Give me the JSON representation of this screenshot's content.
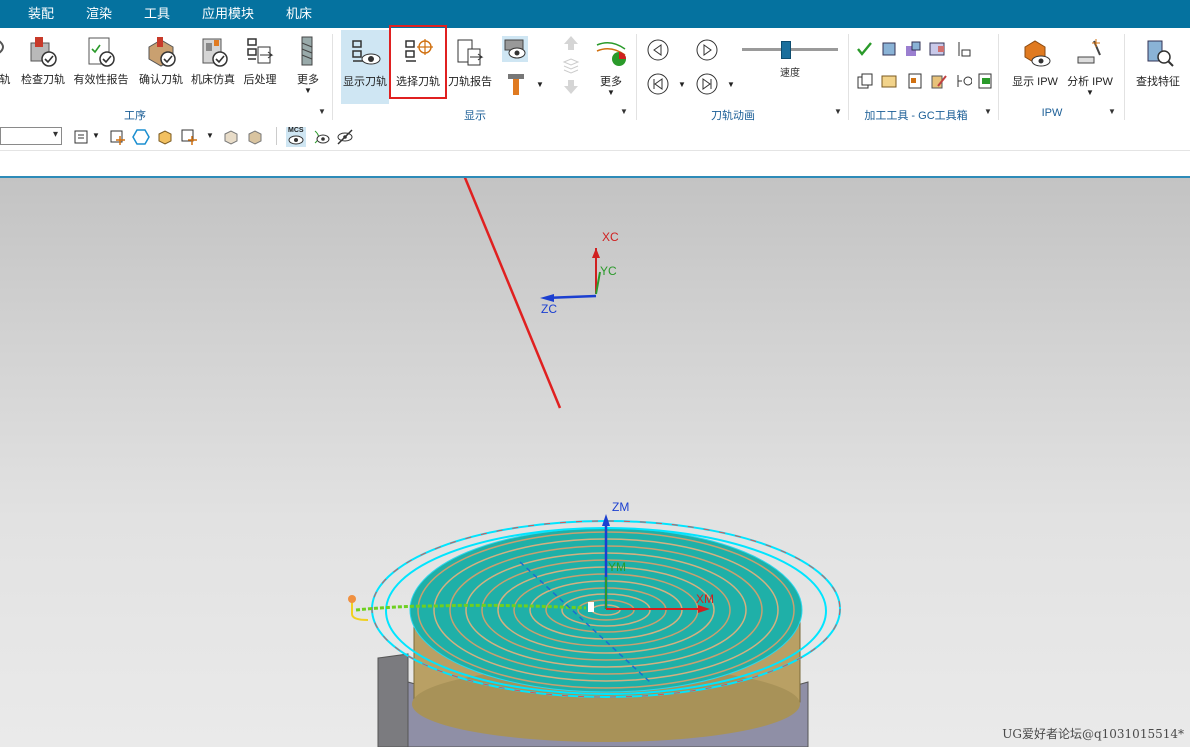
{
  "menubar": {
    "items": [
      {
        "label": "装配"
      },
      {
        "label": "渲染"
      },
      {
        "label": "工具"
      },
      {
        "label": "应用模块"
      },
      {
        "label": "机床"
      }
    ]
  },
  "ribbon": {
    "operation_group": {
      "label": "工序",
      "buttons": [
        {
          "label": "轨"
        },
        {
          "label": "检查刀轨"
        },
        {
          "label": "有效性报告"
        },
        {
          "label": "确认刀轨"
        },
        {
          "label": "机床仿真"
        },
        {
          "label": "后处理"
        },
        {
          "label": "更多"
        }
      ]
    },
    "display_group": {
      "label": "显示",
      "buttons": [
        {
          "label": "显示刀轨"
        },
        {
          "label": "选择刀轨"
        },
        {
          "label": "刀轨报告"
        },
        {
          "label": "更多"
        }
      ]
    },
    "animation_group": {
      "label": "刀轨动画",
      "speed_label": "速度",
      "speed_value": 0.45
    },
    "gc_group": {
      "label": "加工工具 - GC工具箱"
    },
    "ipw_group": {
      "label": "IPW",
      "buttons": [
        {
          "label": "显示 IPW"
        },
        {
          "label": "分析 IPW"
        }
      ]
    },
    "find_group": {
      "buttons": [
        {
          "label": "查找特征"
        }
      ]
    }
  },
  "toolbar2": {
    "mcs_label": "MCS"
  },
  "viewport": {
    "triad": {
      "x": "XC",
      "y": "YC",
      "z": "ZC"
    },
    "wcs": {
      "x": "XM",
      "y": "YM",
      "z": "ZM"
    }
  },
  "watermark": "UG爱好者论坛@q1031015514*",
  "colors": {
    "menubar": "#05729f",
    "accent": "#1b5e96",
    "highlight": "#e02020",
    "toolpath": "#00e5ff"
  }
}
